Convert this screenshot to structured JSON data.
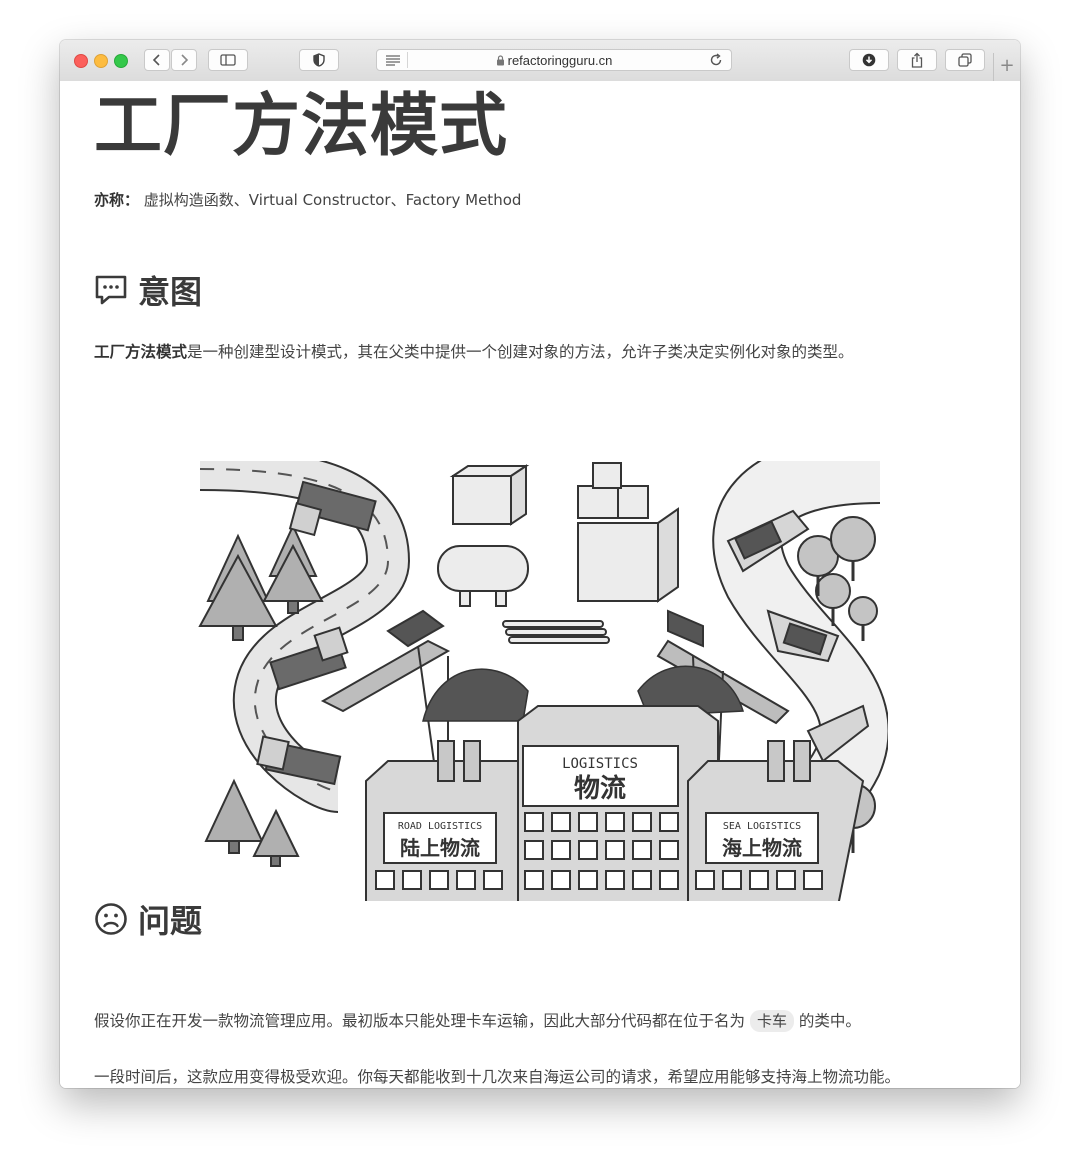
{
  "browser": {
    "url": "refactoringguru.cn",
    "icons": [
      "back-icon",
      "forward-icon",
      "sidebar-icon",
      "privacy-shield-icon",
      "reader-icon",
      "lock-icon",
      "reload-icon",
      "download-icon",
      "share-icon",
      "tabs-icon",
      "new-tab-icon"
    ]
  },
  "page": {
    "title": "工厂方法模式",
    "aka_label": "亦称：",
    "aka_value": "虚拟构造函数、Virtual Constructor、Factory Method"
  },
  "intent": {
    "heading": "意图",
    "icon": "speech-bubble-icon",
    "bold_lead": "工厂方法模式",
    "text": "是一种创建型设计模式，其在父类中提供一个创建对象的方法，允许子类决定实例化对象的类型。"
  },
  "illustration": {
    "center_sign_en": "LOGISTICS",
    "center_sign_cn": "物流",
    "left_sign_en": "ROAD LOGISTICS",
    "left_sign_cn": "陆上物流",
    "right_sign_en": "SEA LOGISTICS",
    "right_sign_cn": "海上物流"
  },
  "problem": {
    "heading": "问题",
    "icon": "sad-face-icon",
    "p1_before": "假设你正在开发一款物流管理应用。最初版本只能处理卡车运输，因此大部分代码都在位于名为",
    "p1_code": "卡车",
    "p1_after": "的类中。",
    "p2": "一段时间后，这款应用变得极受欢迎。你每天都能收到十几次来自海运公司的请求，希望应用能够支持海上物流功能。"
  }
}
